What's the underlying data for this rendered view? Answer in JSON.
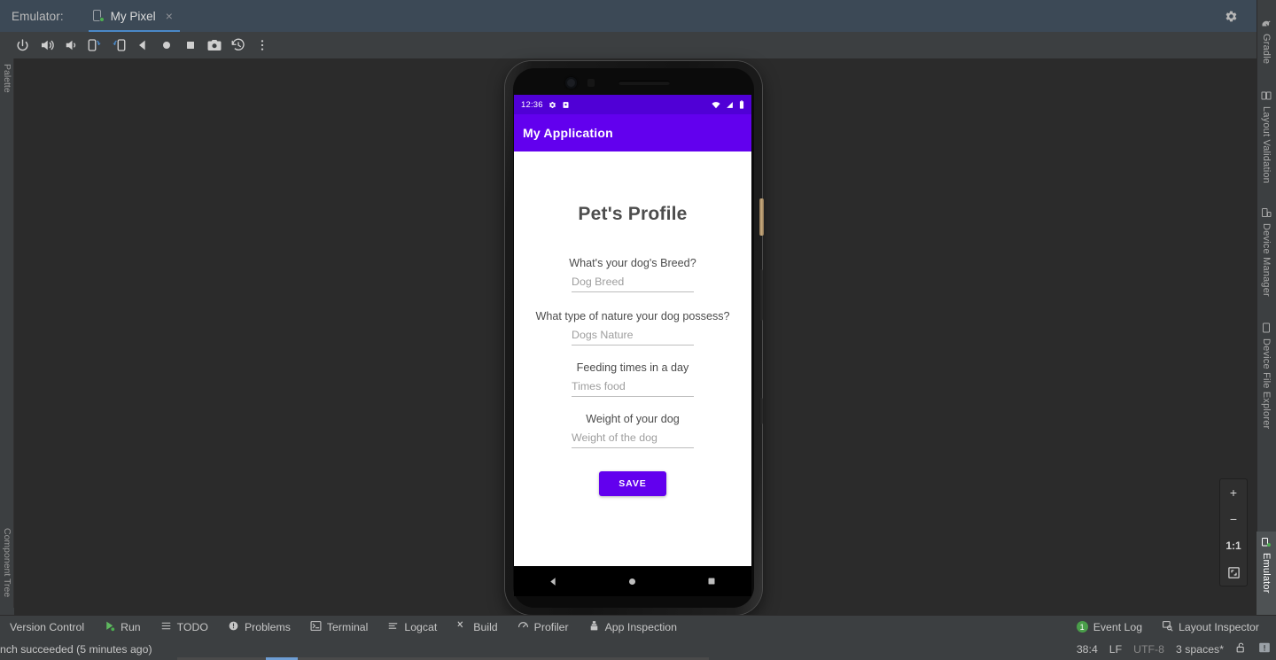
{
  "window": {
    "emulator_label": "Emulator:",
    "tab_title": "My Pixel",
    "tab_close": "×",
    "settings_icon": "gear-icon",
    "minimize_icon": "minimize-icon"
  },
  "toolbar": {
    "buttons": [
      {
        "name": "power-button",
        "icon": "power-icon"
      },
      {
        "name": "volume-up-button",
        "icon": "volume-up-icon"
      },
      {
        "name": "volume-down-button",
        "icon": "volume-down-icon"
      },
      {
        "name": "rotate-left-button",
        "icon": "rotate-left-icon"
      },
      {
        "name": "rotate-right-button",
        "icon": "rotate-right-icon"
      },
      {
        "name": "back-button",
        "icon": "triangle-back-icon"
      },
      {
        "name": "home-button",
        "icon": "circle-home-icon"
      },
      {
        "name": "overview-button",
        "icon": "square-overview-icon"
      },
      {
        "name": "screenshot-button",
        "icon": "camera-icon"
      },
      {
        "name": "rotate-history-button",
        "icon": "history-rotate-icon"
      },
      {
        "name": "more-button",
        "icon": "kebab-menu-icon"
      }
    ]
  },
  "left_rail": {
    "items": [
      {
        "label": "Palette",
        "icon": "palette-icon"
      },
      {
        "label": "Component Tree",
        "icon": "component-tree-icon"
      }
    ]
  },
  "right_rail": {
    "items": [
      {
        "label": "Gradle",
        "icon": "gradle-icon",
        "selected": false
      },
      {
        "label": "Layout Validation",
        "icon": "layout-validation-icon",
        "selected": false
      },
      {
        "label": "Device Manager",
        "icon": "device-manager-icon",
        "selected": false
      },
      {
        "label": "Device File Explorer",
        "icon": "device-file-explorer-icon",
        "selected": false
      },
      {
        "label": "Emulator",
        "icon": "emulator-icon",
        "selected": true
      }
    ]
  },
  "zoom_controls": {
    "zoom_in": "+",
    "zoom_out": "−",
    "actual_size": "1:1",
    "fit_icon": "fit-to-screen-icon"
  },
  "device": {
    "status_bar": {
      "time": "12:36",
      "icons_left": [
        "gear-icon",
        "app-notification-icon"
      ],
      "icons_right": [
        "wifi-icon",
        "cellular-signal-icon",
        "battery-icon"
      ]
    },
    "app_bar": {
      "title": "My Application"
    },
    "screen": {
      "heading": "Pet's Profile",
      "fields": [
        {
          "label": "What's your dog's Breed?",
          "placeholder": "Dog Breed",
          "value": ""
        },
        {
          "label": "What type of nature your dog possess?",
          "placeholder": "Dogs Nature",
          "value": ""
        },
        {
          "label": "Feeding times in a day",
          "placeholder": "Times food",
          "value": ""
        },
        {
          "label": "Weight of your dog",
          "placeholder": "Weight of the dog",
          "value": ""
        }
      ],
      "save_button": "SAVE"
    },
    "nav_bar": {
      "back": "back-triangle-icon",
      "home": "home-circle-icon",
      "recents": "recents-square-icon"
    }
  },
  "bottom_bar": {
    "items": [
      {
        "label": "Version Control",
        "icon": "version-control-icon"
      },
      {
        "label": "Run",
        "icon": "run-play-icon"
      },
      {
        "label": "TODO",
        "icon": "todo-list-icon"
      },
      {
        "label": "Problems",
        "icon": "problems-warning-icon"
      },
      {
        "label": "Terminal",
        "icon": "terminal-icon"
      },
      {
        "label": "Logcat",
        "icon": "logcat-icon"
      },
      {
        "label": "Build",
        "icon": "build-hammer-icon"
      },
      {
        "label": "Profiler",
        "icon": "profiler-icon"
      },
      {
        "label": "App Inspection",
        "icon": "app-inspection-icon"
      }
    ],
    "right_items": [
      {
        "label": "Event Log",
        "icon": "event-log-icon",
        "badge": "1"
      },
      {
        "label": "Layout Inspector",
        "icon": "layout-inspector-icon",
        "badge": ""
      }
    ]
  },
  "status_bar": {
    "message": "nch succeeded (5 minutes ago)",
    "caret": "38:4",
    "line_separator": "LF",
    "encoding": "UTF-8",
    "indent": "3 spaces*",
    "lock_icon": "unlocked-padlock-icon",
    "notification_icon": "notification-exclamation-icon"
  },
  "colors": {
    "accent_purple": "#6200EE",
    "status_purple": "#5000D6",
    "ide_chrome": "#3C3F41",
    "tab_header": "#3C4956",
    "tab_underline": "#4A88C7",
    "canvas": "#2B2B2B",
    "badge_green": "#4A9E4A"
  }
}
